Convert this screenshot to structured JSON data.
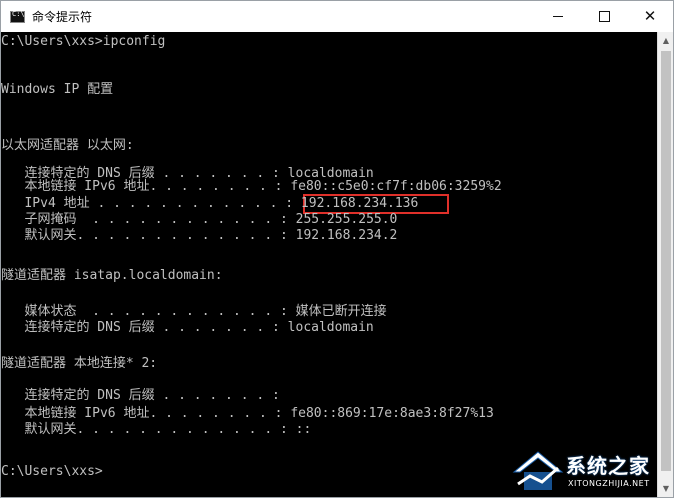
{
  "window": {
    "title": "命令提示符",
    "minimize_label": "",
    "maximize_label": "",
    "close_glyph": "✕"
  },
  "console": {
    "lines": [
      "C:\\Users\\xxs>ipconfig",
      "",
      "Windows IP 配置",
      "",
      "",
      "以太网适配器 以太网:",
      "",
      "   连接特定的 DNS 后缀 . . . . . . . : localdomain",
      "   本地链接 IPv6 地址. . . . . . . . : fe80::c5e0:cf7f:db06:3259%2",
      "   IPv4 地址 . . . . . . . . . . . . : 192.168.234.136",
      "   子网掩码  . . . . . . . . . . . . : 255.255.255.0",
      "   默认网关. . . . . . . . . . . . . : 192.168.234.2",
      "",
      "隧道适配器 isatap.localdomain:",
      "",
      "   媒体状态  . . . . . . . . . . . . : 媒体已断开连接",
      "   连接特定的 DNS 后缀 . . . . . . . : localdomain",
      "",
      "隧道适配器 本地连接* 2:",
      "",
      "   连接特定的 DNS 后缀 . . . . . . . :",
      "   本地链接 IPv6 地址. . . . . . . . : fe80::869:17e:8ae3:8f27%13",
      "   默认网关. . . . . . . . . . . . . : ::",
      "",
      "C:\\Users\\xxs>"
    ]
  },
  "colors": {
    "console_bg": "#000000",
    "console_text": "#c0c0c0",
    "highlight_border": "#e0302a",
    "titlebar_bg": "#ffffff"
  },
  "watermark": {
    "name": "系统之家",
    "url": "XITONGZHIJIA.NET"
  },
  "icons": {
    "app": "cmd-icon",
    "minimize": "minimize-icon",
    "maximize": "maximize-icon",
    "close": "close-icon"
  }
}
